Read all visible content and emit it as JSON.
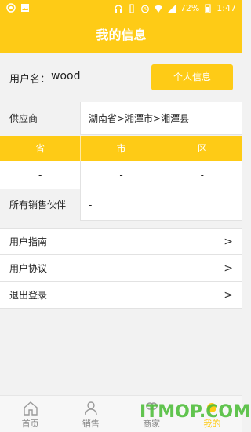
{
  "status_bar": {
    "battery": "72%",
    "time": "1:47"
  },
  "header": {
    "title": "我的信息"
  },
  "user": {
    "label": "用户名：",
    "value": "wood",
    "profile_button": "个人信息"
  },
  "supplier": {
    "label": "供应商",
    "value": "湖南省>湘潭市>湘潭县"
  },
  "region": {
    "headers": [
      "省",
      "市",
      "区"
    ],
    "values": [
      "-",
      "-",
      "-"
    ]
  },
  "partners": {
    "label": "所有销售伙伴",
    "value": "-"
  },
  "menu": [
    {
      "label": "用户指南",
      "chevron": ">"
    },
    {
      "label": "用户协议",
      "chevron": ">"
    },
    {
      "label": "退出登录",
      "chevron": ">"
    }
  ],
  "tabbar": [
    {
      "label": "首页",
      "icon": "home-icon"
    },
    {
      "label": "销售",
      "icon": "person-icon"
    },
    {
      "label": "商家",
      "icon": "store-icon"
    },
    {
      "label": "我的",
      "icon": "me-icon",
      "active": true
    }
  ],
  "watermark": "ITMOP.COM",
  "colors": {
    "accent": "#fecb16"
  }
}
